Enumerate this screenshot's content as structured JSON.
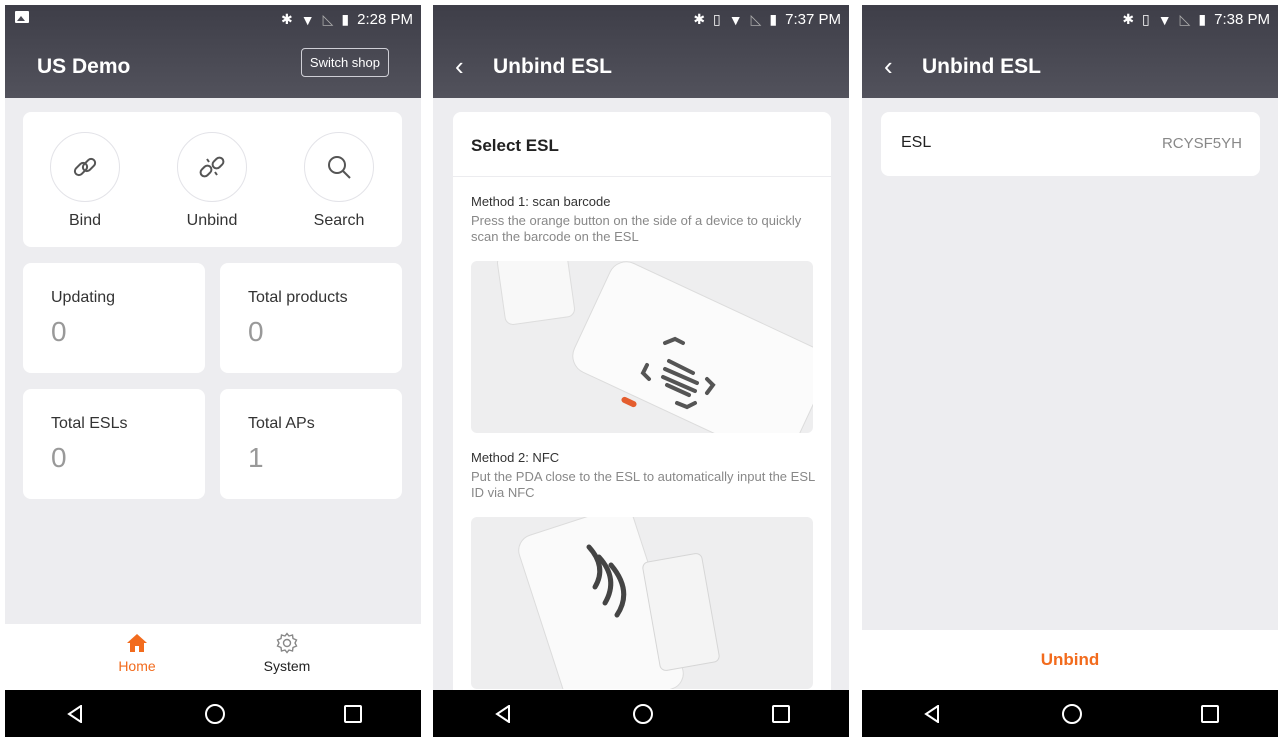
{
  "colors": {
    "accent": "#f26b1d",
    "appbar": "#4a4a54",
    "background": "#ededf0"
  },
  "screen1": {
    "status": {
      "time": "2:28 PM",
      "icons": [
        "image-icon",
        "bluetooth-icon",
        "wifi-icon",
        "no-signal-icon",
        "battery-icon"
      ]
    },
    "title": "US Demo",
    "switch_shop": "Switch shop",
    "actions": [
      {
        "label": "Bind",
        "icon": "link-icon"
      },
      {
        "label": "Unbind",
        "icon": "unlink-icon"
      },
      {
        "label": "Search",
        "icon": "search-icon"
      }
    ],
    "stats": [
      {
        "label": "Updating",
        "value": "0"
      },
      {
        "label": "Total products",
        "value": "0"
      },
      {
        "label": "Total ESLs",
        "value": "0"
      },
      {
        "label": "Total APs",
        "value": "1"
      }
    ],
    "tabs": [
      {
        "label": "Home",
        "icon": "home-icon",
        "active": true
      },
      {
        "label": "System",
        "icon": "gear-icon",
        "active": false
      }
    ]
  },
  "screen2": {
    "status": {
      "time": "7:37 PM"
    },
    "title": "Unbind ESL",
    "card_title": "Select ESL",
    "method1": {
      "title": "Method 1: scan barcode",
      "desc": "Press the orange button on the side of a device to quickly scan the barcode on the ESL"
    },
    "method2": {
      "title": "Method 2: NFC",
      "desc": "Put the PDA close to the ESL to automatically input the ESL ID via NFC"
    }
  },
  "screen3": {
    "status": {
      "time": "7:38 PM"
    },
    "title": "Unbind ESL",
    "esl_label": "ESL",
    "esl_value": "RCYSF5YH",
    "unbind_button": "Unbind"
  }
}
